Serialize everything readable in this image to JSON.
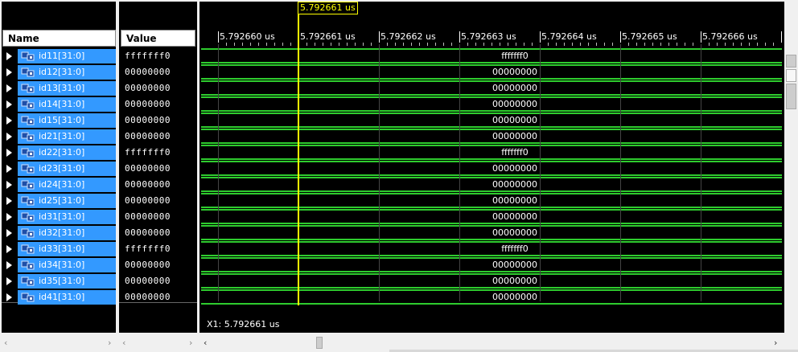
{
  "headers": {
    "name": "Name",
    "value": "Value"
  },
  "timeline": {
    "ticks": [
      "5.792660 us",
      "5.792661 us",
      "5.792662 us",
      "5.792663 us",
      "5.792664 us",
      "5.792665 us",
      "5.792666 us"
    ],
    "cursor_label": "5.792661 us",
    "readout": "X1: 5.792661 us"
  },
  "signals": [
    {
      "name": "id11[31:0]",
      "value": "fffffff0",
      "wave": "fffffff0"
    },
    {
      "name": "id12[31:0]",
      "value": "00000000",
      "wave": "00000000"
    },
    {
      "name": "id13[31:0]",
      "value": "00000000",
      "wave": "00000000"
    },
    {
      "name": "id14[31:0]",
      "value": "00000000",
      "wave": "00000000"
    },
    {
      "name": "id15[31:0]",
      "value": "00000000",
      "wave": "00000000"
    },
    {
      "name": "id21[31:0]",
      "value": "00000000",
      "wave": "00000000"
    },
    {
      "name": "id22[31:0]",
      "value": "fffffff0",
      "wave": "fffffff0"
    },
    {
      "name": "id23[31:0]",
      "value": "00000000",
      "wave": "00000000"
    },
    {
      "name": "id24[31:0]",
      "value": "00000000",
      "wave": "00000000"
    },
    {
      "name": "id25[31:0]",
      "value": "00000000",
      "wave": "00000000"
    },
    {
      "name": "id31[31:0]",
      "value": "00000000",
      "wave": "00000000"
    },
    {
      "name": "id32[31:0]",
      "value": "00000000",
      "wave": "00000000"
    },
    {
      "name": "id33[31:0]",
      "value": "fffffff0",
      "wave": "fffffff0"
    },
    {
      "name": "id34[31:0]",
      "value": "00000000",
      "wave": "00000000"
    },
    {
      "name": "id35[31:0]",
      "value": "00000000",
      "wave": "00000000"
    },
    {
      "name": "id41[31:0]",
      "value": "00000000",
      "wave": "00000000"
    }
  ],
  "colors": {
    "wave": "#2ecc2e",
    "cursor": "#ffff00",
    "selection": "#3399ff",
    "background": "#000000"
  },
  "icons": {
    "expand": "expand-triangle-icon",
    "bus": "bus-signal-icon"
  }
}
